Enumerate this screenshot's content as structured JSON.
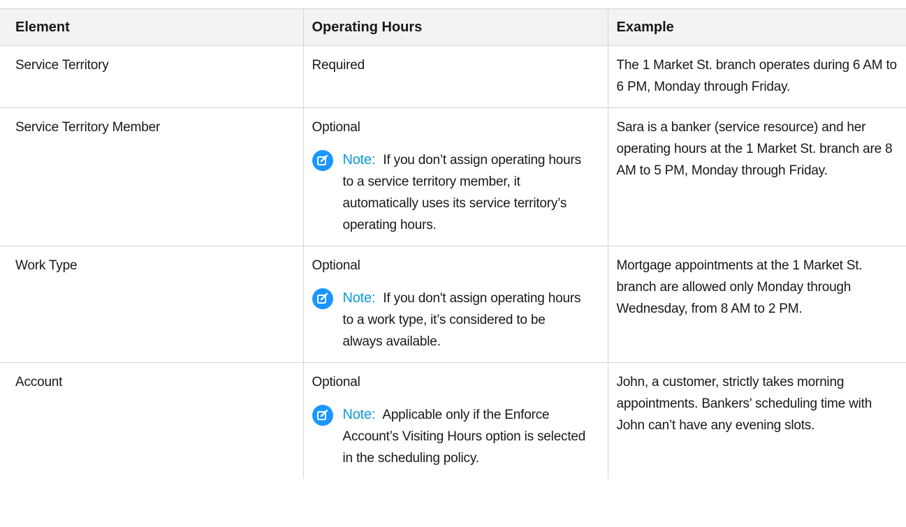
{
  "table": {
    "headers": [
      "Element",
      "Operating Hours",
      "Example"
    ],
    "rows": [
      {
        "element": "Service Territory",
        "hours": "Required",
        "note_label": "",
        "note": "",
        "example": "The 1 Market St. branch operates during 6 AM to 6 PM, Monday through Friday."
      },
      {
        "element": "Service Territory Member",
        "hours": "Optional",
        "note_label": "Note:",
        "note": "If you don’t assign operating hours to a service territory member, it automatically uses its service territory’s operating hours.",
        "example": "Sara is a banker (service resource) and her operating hours at the 1 Market St. branch are 8 AM to 5 PM, Monday through Friday."
      },
      {
        "element": "Work Type",
        "hours": "Optional",
        "note_label": "Note:",
        "note": "If you don't assign operating hours to a work type, it’s considered to be always available.",
        "example": "Mortgage appointments at the 1 Market St. branch are allowed only Monday through Wednesday, from 8 AM to 2 PM."
      },
      {
        "element": "Account",
        "hours": "Optional",
        "note_label": "Note:",
        "note": "Applicable only if the Enforce Account’s Visiting Hours option is selected in the scheduling policy.",
        "example": "John, a customer, strictly takes morning appointments. Bankers’ scheduling time with John can’t have any evening slots."
      }
    ]
  },
  "icons": {
    "note": "edit-note-icon"
  },
  "colors": {
    "header_bg": "#f3f3f3",
    "note_label": "#0b9bd8",
    "note_icon": "#1b96ff",
    "border": "#d4d4d4"
  }
}
